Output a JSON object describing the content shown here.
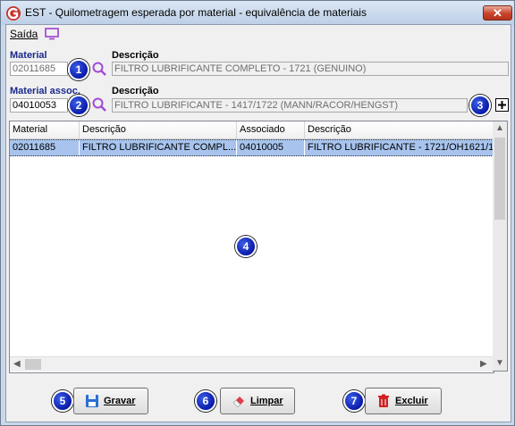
{
  "window": {
    "title": "EST - Quilometragem esperada por material - equivalência de materiais",
    "close_symbol": "✕",
    "app_icon": "app-logo-icon"
  },
  "menu": {
    "saida": "Saída",
    "monitor_icon": "monitor-icon"
  },
  "material": {
    "label": "Material",
    "code": "02011685",
    "desc_label": "Descrição",
    "desc": "FILTRO LUBRIFICANTE COMPLETO - 1721 (GENUINO)"
  },
  "material_assoc": {
    "label": "Material assoc.",
    "code": "04010053",
    "desc_label": "Descrição",
    "desc": "FILTRO LUBRIFICANTE - 1417/1722 (MANN/RACOR/HENGST)"
  },
  "badges": [
    "1",
    "2",
    "3",
    "4",
    "5",
    "6",
    "7"
  ],
  "grid": {
    "columns": [
      "Material",
      "Descrição",
      "Associado",
      "Descrição"
    ],
    "rows": [
      {
        "material": "02011685",
        "descricao": "FILTRO LUBRIFICANTE COMPL...",
        "associado": "04010005",
        "descricao2": "FILTRO LUBRIFICANTE - 1721/OH1621/1"
      }
    ],
    "selected_row": 0
  },
  "buttons": {
    "gravar": "Gravar",
    "limpar": "Limpar",
    "excluir": "Excluir"
  },
  "colors": {
    "badge": "#0a1aa8",
    "selected_row": "#a8c4ee",
    "close": "#c8432b",
    "label_blue": "#1a2a8c",
    "search_icon": "#a14ad6"
  }
}
